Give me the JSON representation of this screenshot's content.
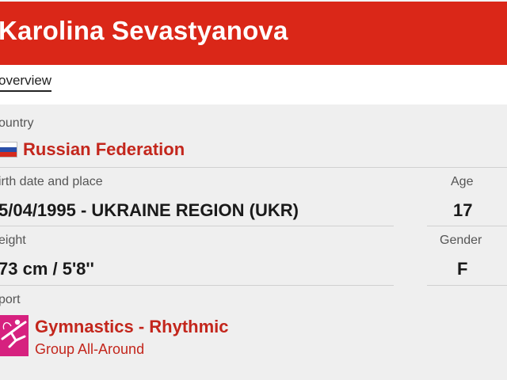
{
  "header": {
    "athlete_name": "Karolina Sevastyanova"
  },
  "tabs": [
    {
      "label": "overview"
    }
  ],
  "country": {
    "label": "ountry",
    "value": "Russian Federation",
    "flag_icon": "russia-flag-icon"
  },
  "birth": {
    "label": "irth date and place",
    "value": "5/04/1995 - UKRAINE REGION (UKR)"
  },
  "age": {
    "label": "Age",
    "value": "17"
  },
  "height": {
    "label": "eight",
    "value": "73 cm / 5'8''"
  },
  "gender": {
    "label": "Gender",
    "value": "F"
  },
  "sport": {
    "label": "port",
    "name": "Gymnastics - Rhythmic",
    "event": "Group All-Around",
    "icon": "rhythmic-gymnastics-icon"
  },
  "colors": {
    "header_red": "#da2718",
    "accent_red": "#c3261c",
    "sport_magenta": "#d6217f",
    "background": "#efefef"
  }
}
